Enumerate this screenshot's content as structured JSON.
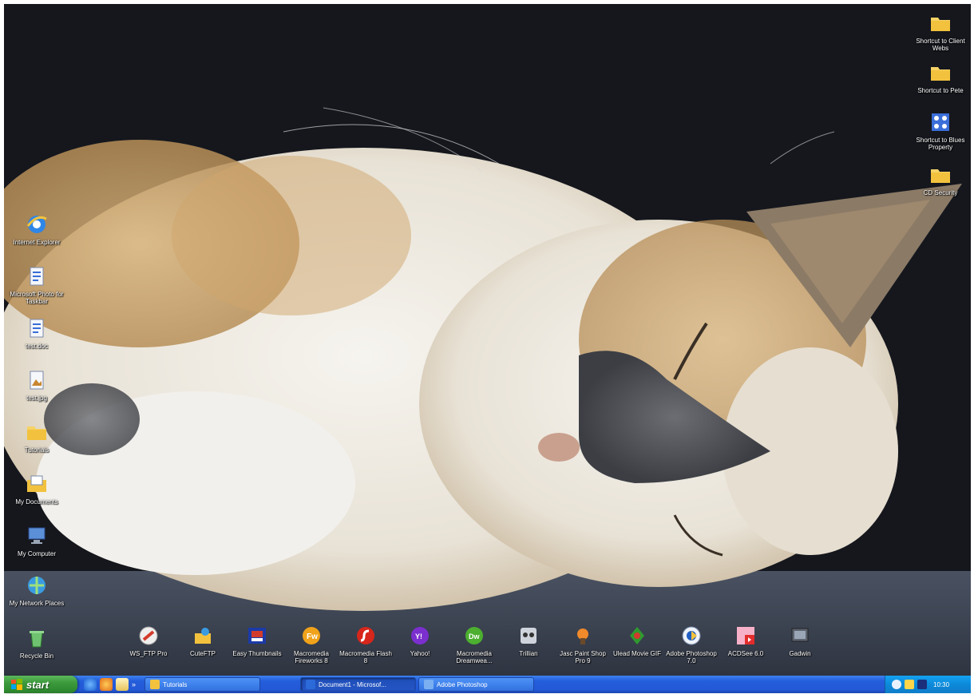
{
  "desktop": {
    "left_icons": [
      {
        "label": "Internet Explorer",
        "icon": "internet-explorer-icon"
      },
      {
        "label": "Microsoft Photo for Taskbar",
        "icon": "document-icon"
      },
      {
        "label": "test.doc",
        "icon": "word-document-icon"
      },
      {
        "label": "test.jpg",
        "icon": "image-file-icon"
      },
      {
        "label": "Tutorials",
        "icon": "folder-icon"
      },
      {
        "label": "My Documents",
        "icon": "my-documents-icon"
      },
      {
        "label": "My Computer",
        "icon": "my-computer-icon"
      },
      {
        "label": "My Network Places",
        "icon": "network-places-icon"
      },
      {
        "label": "Recycle Bin",
        "icon": "recycle-bin-icon"
      }
    ],
    "right_icons": [
      {
        "label": "Shortcut to Client Webs",
        "icon": "folder-icon"
      },
      {
        "label": "Shortcut to Pete",
        "icon": "folder-icon"
      },
      {
        "label": "Shortcut to Blues Property",
        "icon": "network-folder-icon"
      },
      {
        "label": "CD Security",
        "icon": "folder-icon"
      }
    ],
    "bottom_icons": [
      {
        "label": "WS_FTP Pro",
        "icon": "ftp-icon"
      },
      {
        "label": "CuteFTP",
        "icon": "cuteftp-icon"
      },
      {
        "label": "Easy Thumbnails",
        "icon": "thumbnails-icon"
      },
      {
        "label": "Macromedia Fireworks 8",
        "icon": "fireworks-icon"
      },
      {
        "label": "Macromedia Flash 8",
        "icon": "flash-icon"
      },
      {
        "label": "Yahoo!",
        "icon": "yahoo-icon"
      },
      {
        "label": "Macromedia Dreamwea...",
        "icon": "dreamweaver-icon"
      },
      {
        "label": "Trillian",
        "icon": "trillian-icon"
      },
      {
        "label": "Jasc Paint Shop Pro 9",
        "icon": "paint-shop-icon"
      },
      {
        "label": "Ulead Movie GIF",
        "icon": "movie-gif-icon"
      },
      {
        "label": "Adobe Photoshop 7.0",
        "icon": "photoshop-icon"
      },
      {
        "label": "ACDSee 6.0",
        "icon": "acdsee-icon"
      },
      {
        "label": "Gadwin",
        "icon": "screenshot-tool-icon"
      }
    ]
  },
  "taskbar": {
    "start_label": "start",
    "quick_launch": [
      "internet-explorer-icon",
      "firefox-icon",
      "outlook-icon"
    ],
    "tasks": [
      {
        "label": "Tutorials",
        "icon": "folder-icon",
        "active": false
      },
      {
        "label": "Document1 - Microsof...",
        "icon": "word-icon",
        "active": true
      },
      {
        "label": "Adobe Photoshop",
        "icon": "photoshop-icon",
        "active": false
      }
    ],
    "tray": {
      "icons": [
        "network-icon",
        "volume-icon",
        "security-icon"
      ],
      "clock": "10:30"
    }
  },
  "colors": {
    "taskbar_blue": "#245edb",
    "start_green": "#3c9a3c",
    "tray_blue": "#0d8ad9",
    "wallpaper_floor": "#3b4250"
  }
}
